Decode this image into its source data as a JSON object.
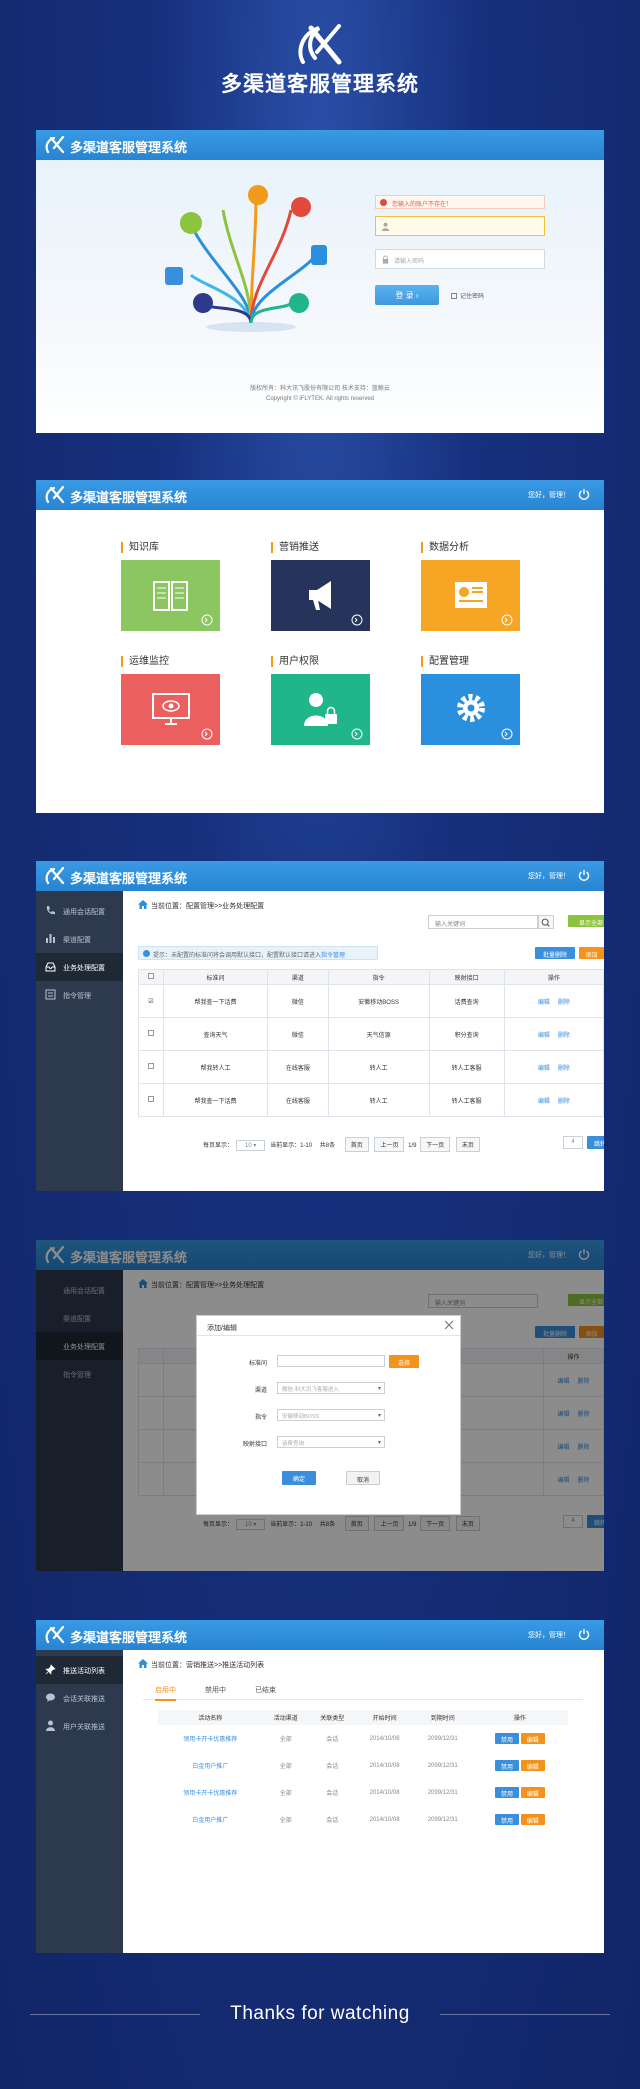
{
  "app": {
    "title": "多渠道客服管理系统"
  },
  "login": {
    "alert": "您输入的账户不存在！",
    "username_placeholder": "",
    "password_placeholder": "请输入密码",
    "login_label": "登 录",
    "remember_label": "记住密码",
    "footer_line1": "版权所有：科大讯飞股份有限公司    技术支持：蓝鲸云",
    "footer_line2": "Copyright © iFLYTEK. All rights reserved"
  },
  "header": {
    "user_text": "您好，管理！"
  },
  "modules": [
    {
      "label": "知识库",
      "color": "#8cc660",
      "icon": "book-icon"
    },
    {
      "label": "营销推送",
      "color": "#26335a",
      "icon": "megaphone-icon"
    },
    {
      "label": "数据分析",
      "color": "#f6a524",
      "icon": "report-icon"
    },
    {
      "label": "运维监控",
      "color": "#ec5f5f",
      "icon": "monitor-icon"
    },
    {
      "label": "用户权限",
      "color": "#21b58a",
      "icon": "user-lock-icon"
    },
    {
      "label": "配置管理",
      "color": "#2a8fdc",
      "icon": "gear-icon"
    }
  ],
  "sidebar_config": [
    {
      "label": "通用会话配置",
      "icon": "phone-icon"
    },
    {
      "label": "渠道配置",
      "icon": "chart-icon"
    },
    {
      "label": "业务处理配置",
      "icon": "inbox-icon",
      "active": true
    },
    {
      "label": "指令管理",
      "icon": "list-icon"
    }
  ],
  "business": {
    "breadcrumb": "当前位置：配置管理>>业务处理配置",
    "search_placeholder": "输入关键词",
    "show_all": "显示全部",
    "batch_delete": "批量删除",
    "add": "添加",
    "tip": "提示：未配置的标准问将会调用默认接口，配置默认接口请进入",
    "tip_link": "指令管理",
    "columns": [
      "标准问",
      "渠道",
      "指令",
      "映射接口",
      "操作"
    ],
    "rows": [
      [
        "帮我查一下话费",
        "微信",
        "安徽移动BOSS",
        "话费查询"
      ],
      [
        "查询天气",
        "微信",
        "天气信源",
        "积分查询"
      ],
      [
        "帮我转人工",
        "在线客服",
        "转人工",
        "转人工客服"
      ],
      [
        "帮我查一下话费",
        "在线客服",
        "转人工",
        "转人工客服"
      ]
    ],
    "edit": "编辑",
    "delete": "删除",
    "pager": {
      "per_page_label": "每页显示：",
      "per_page": "10",
      "range": "当前显示：1-10",
      "total": "共8条",
      "first": "首页",
      "prev": "上一页",
      "page": "1/9",
      "next": "下一页",
      "last": "末页",
      "goto_value": "4",
      "goto": "跳转"
    }
  },
  "modal": {
    "title": "添加/编辑",
    "fields": [
      {
        "label": "标准问",
        "value": ""
      },
      {
        "label": "渠道",
        "value": "微信-科大讯飞客服进入"
      },
      {
        "label": "指令",
        "value": "安徽移动BOSS"
      },
      {
        "label": "映射接口",
        "value": "话费查询"
      }
    ],
    "select_btn": "选择",
    "ok": "确定",
    "cancel": "取消"
  },
  "sidebar_marketing": [
    {
      "label": "推送活动列表",
      "icon": "pin-icon",
      "active": true
    },
    {
      "label": "会话关联推送",
      "icon": "chat-icon"
    },
    {
      "label": "用户关联推送",
      "icon": "person-icon"
    }
  ],
  "marketing": {
    "breadcrumb": "当前位置：营销推送>>推送活动列表",
    "tabs": [
      "启用中",
      "禁用中",
      "已结束"
    ],
    "columns": [
      "活动名称",
      "活动渠道",
      "关联类型",
      "开始时间",
      "到期时间",
      "操作"
    ],
    "rows": [
      [
        "领用卡开卡优惠推荐",
        "全部",
        "会话",
        "2014/10/08",
        "2099/12/31"
      ],
      [
        "白金用户推广",
        "全部",
        "会话",
        "2014/10/08",
        "2099/12/31"
      ],
      [
        "领用卡开卡优惠推荐",
        "全部",
        "会话",
        "2014/10/08",
        "2099/12/31"
      ],
      [
        "白金用户推广",
        "全部",
        "会话",
        "2014/10/08",
        "2099/12/31"
      ]
    ],
    "disable": "禁用",
    "edit": "编辑"
  },
  "thanks": "Thanks for watching"
}
